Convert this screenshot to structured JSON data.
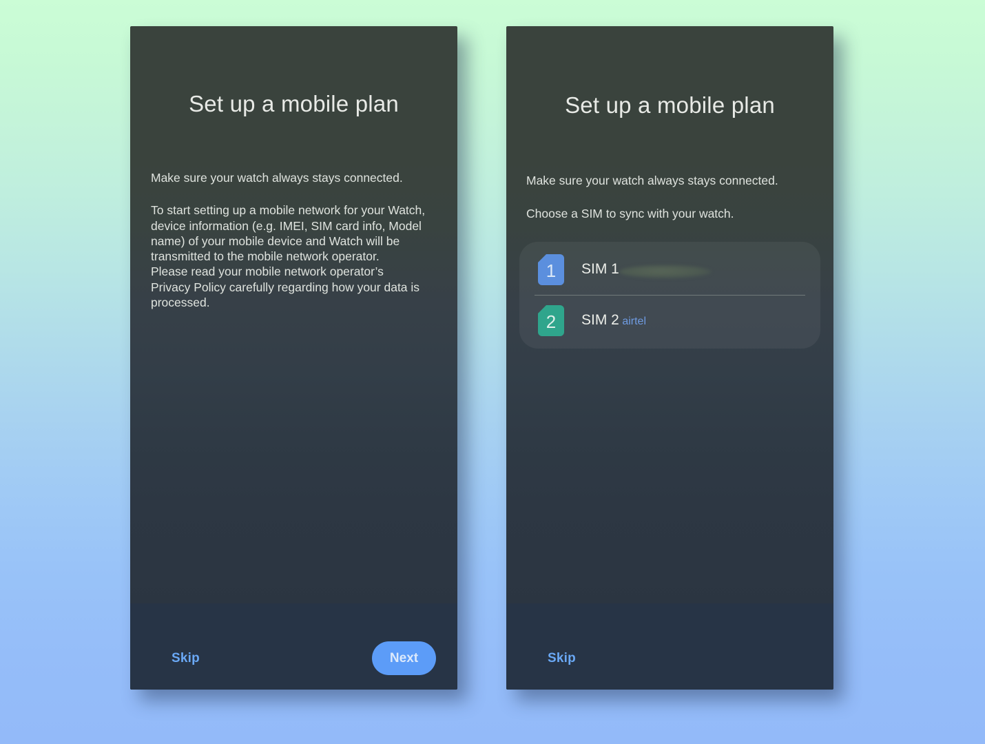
{
  "background": {
    "gradient_top": "#cbfdd6",
    "gradient_bottom": "#93baf9"
  },
  "colors": {
    "panel_top": "#3a433d",
    "panel_bottom": "#2b3541",
    "action_bar": "#273446",
    "accent_blue": "#5c9cf8",
    "link_blue": "#6aa8f5",
    "carrier_blue": "#6f9ce2",
    "sim1_icon": "#5b8fde",
    "sim2_icon": "#2fa58c"
  },
  "screens": [
    {
      "name": "intro",
      "title": "Set up a mobile plan",
      "lead": "Make sure your watch always stays connected.",
      "legal": "To start setting up a mobile network for your Watch, device information (e.g. IMEI, SIM card info, Model name) of your mobile device and Watch will be transmitted to the mobile network operator.\nPlease read your mobile network operator’s Privacy Policy carefully regarding how your data is processed.",
      "skip_label": "Skip",
      "next_label": "Next"
    },
    {
      "name": "sim-chooser",
      "title": "Set up a mobile plan",
      "lead": "Make sure your watch always stays connected.",
      "choose": "Choose a SIM to sync with your watch.",
      "skip_label": "Skip",
      "sims": [
        {
          "slot": "1",
          "label": "SIM 1",
          "carrier": "",
          "redacted": true,
          "icon": "sim-card-icon"
        },
        {
          "slot": "2",
          "label": "SIM 2",
          "carrier": "airtel",
          "redacted": false,
          "icon": "sim-card-icon"
        }
      ]
    }
  ]
}
